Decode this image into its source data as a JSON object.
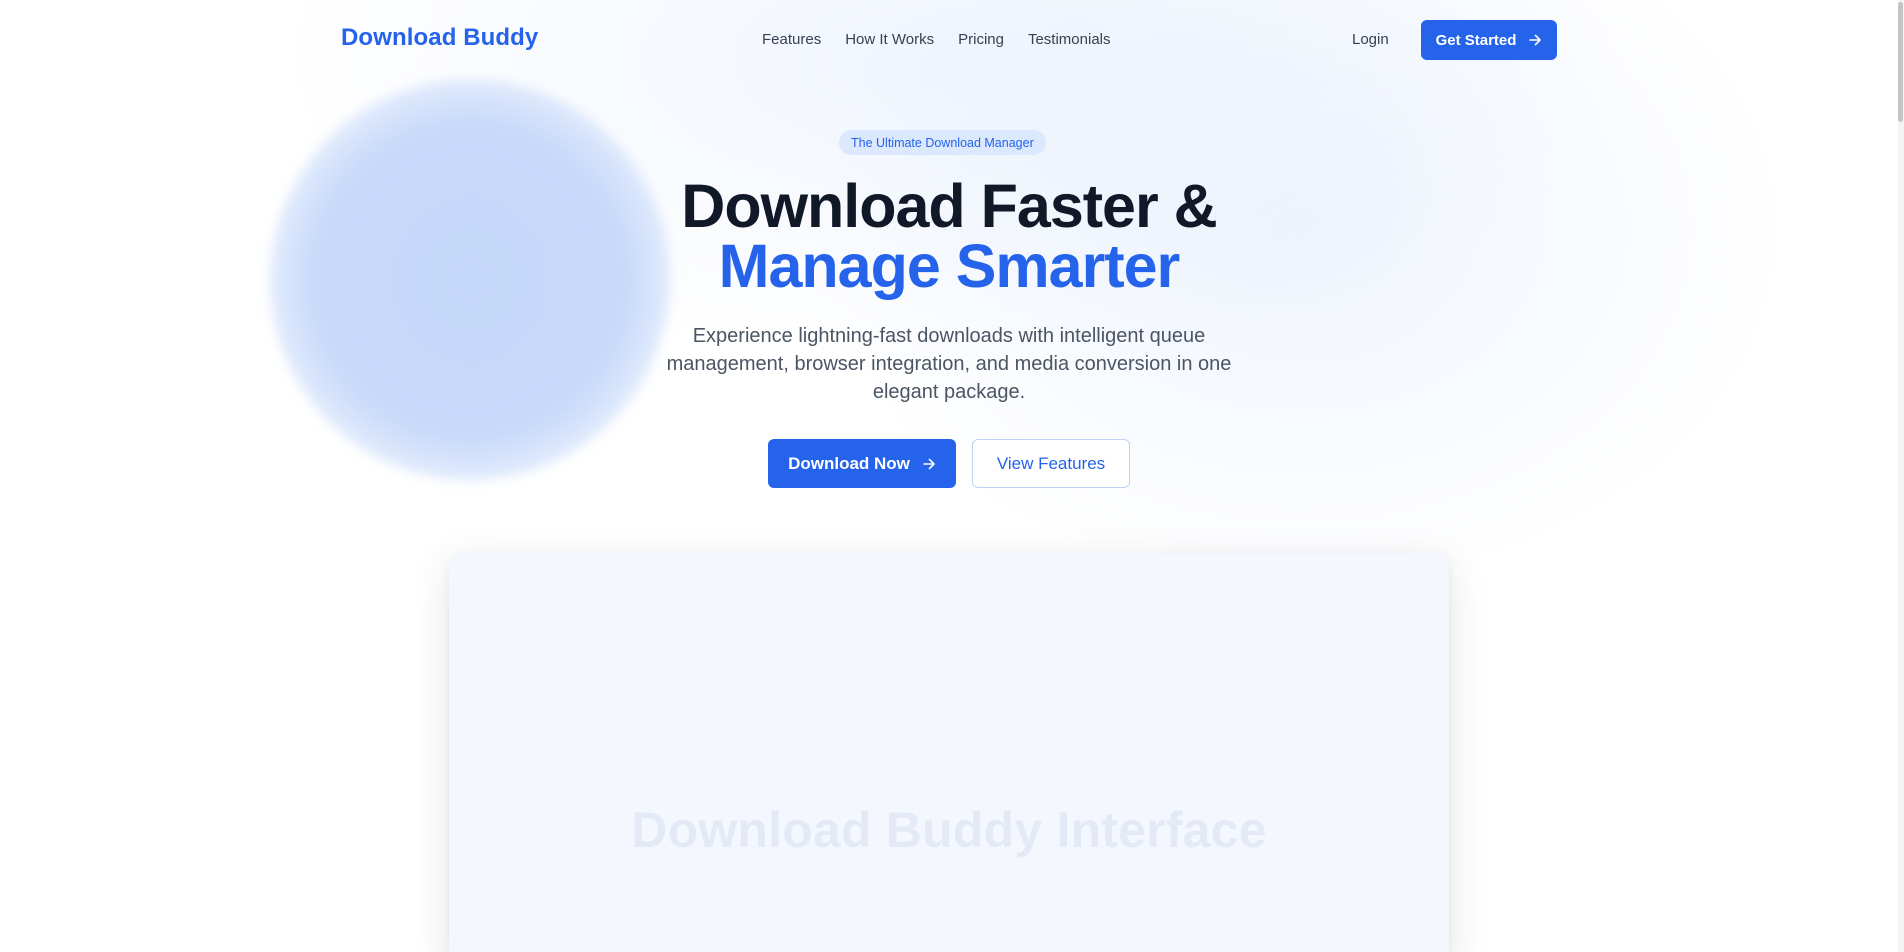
{
  "header": {
    "logo": "Download Buddy",
    "nav": [
      {
        "label": "Features"
      },
      {
        "label": "How It Works"
      },
      {
        "label": "Pricing"
      },
      {
        "label": "Testimonials"
      }
    ],
    "login": "Login",
    "cta": "Get Started",
    "cta_icon": "arrow-right-icon"
  },
  "hero": {
    "badge": "The Ultimate Download Manager",
    "title_line1": "Download Faster &",
    "title_line2": "Manage Smarter",
    "subtitle": "Experience lightning-fast downloads with intelligent queue management, browser integration, and media conversion in one elegant package.",
    "primary_button": "Download Now",
    "primary_icon": "arrow-right-icon",
    "secondary_button": "View Features"
  },
  "preview": {
    "label": "Download Buddy Interface"
  },
  "colors": {
    "brand": "#2563eb",
    "heading": "#111827",
    "body_text": "#4b5563",
    "badge_bg": "#dbe8fd",
    "preview_bg": "#f4f7fd"
  }
}
